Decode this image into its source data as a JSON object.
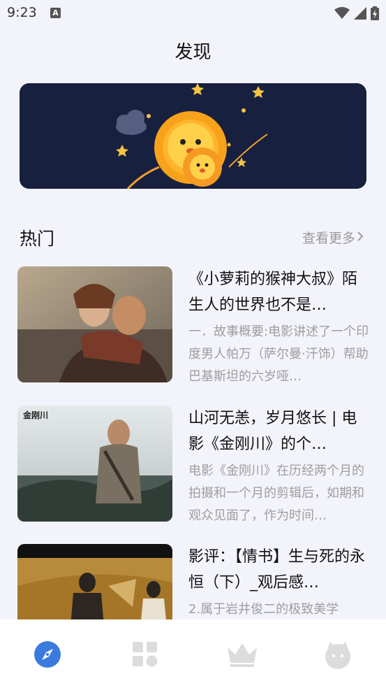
{
  "status_bar": {
    "time": "9:23",
    "notification_icon": "A"
  },
  "page": {
    "title": "发现"
  },
  "banner": {
    "image": "cartoon sun mascot holding small lion on night sky"
  },
  "hot": {
    "title": "热门",
    "more_label": "查看更多"
  },
  "articles": [
    {
      "title": "《小萝莉的猴神大叔》陌生人的世界也不是…",
      "summary": "一．故事概要:电影讲述了一个印度男人帕万（萨尔曼·汗饰）帮助巴基斯坦的六岁哑…"
    },
    {
      "title": "山河无恙，岁月悠长 | 电影《金刚川》的个…",
      "summary": "电影《金刚川》在历经两个月的拍摄和一个月的剪辑后，如期和观众见面了，作为时间…"
    },
    {
      "title": "影评：【情书】生与死的永恒（下）_观后感…",
      "summary": "2.属于岩井俊二的极致美学"
    }
  ],
  "bottom_nav": {
    "items": [
      {
        "icon": "compass-icon",
        "active": true
      },
      {
        "icon": "grid-icon",
        "active": false
      },
      {
        "icon": "crown-icon",
        "active": false
      },
      {
        "icon": "face-icon",
        "active": false
      }
    ],
    "accent": "#3b7be0",
    "inactive": "#dcdcdc"
  }
}
